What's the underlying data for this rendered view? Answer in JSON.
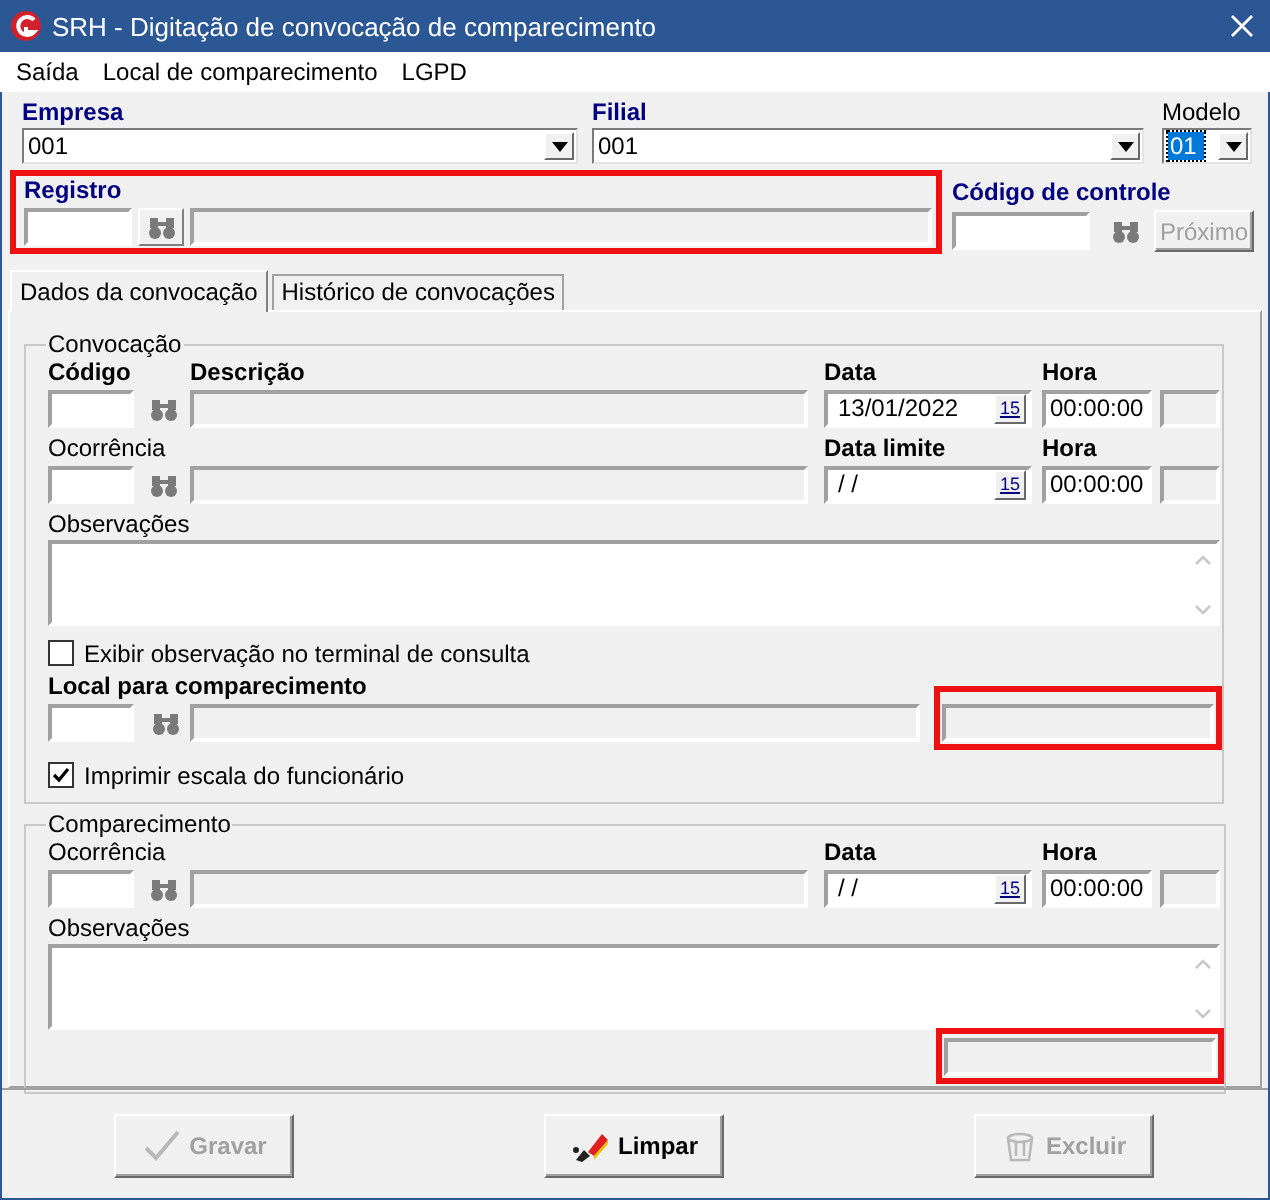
{
  "window": {
    "title": "SRH - Digitação de convocação de comparecimento"
  },
  "menu": [
    "Saída",
    "Local de comparecimento",
    "LGPD"
  ],
  "empresa": {
    "label": "Empresa",
    "value": "001"
  },
  "filial": {
    "label": "Filial",
    "value": "001"
  },
  "modelo": {
    "label": "Modelo",
    "value": "01",
    "focused": true
  },
  "registro": {
    "label": "Registro",
    "highlighted": true
  },
  "codigo_controle": {
    "label": "Código de controle",
    "button": "Próximo",
    "button_disabled": true
  },
  "tabs": [
    {
      "label": "Dados da convocação",
      "selected": true
    },
    {
      "label": "Histórico de convocações",
      "selected": false
    }
  ],
  "convocacao": {
    "title": "Convocação",
    "items": [
      {
        "kind": "lookup",
        "code_label": "Código",
        "code_bold": true,
        "desc_label": "Descrição",
        "date_label": "Data",
        "date": "13/01/2022",
        "calendar": "15",
        "time_label": "Hora",
        "time": "00:00:00"
      },
      {
        "kind": "lookup",
        "code_label": "Ocorrência",
        "code_bold": false,
        "date_label": "Data limite",
        "date": "/ /",
        "calendar": "15",
        "time_label": "Hora",
        "time": "00:00:00"
      },
      {
        "kind": "memo",
        "label": "Observações"
      },
      {
        "kind": "checkbox",
        "label": "Exibir observação no terminal de consulta",
        "checked": false
      },
      {
        "kind": "local",
        "label": "Local para comparecimento",
        "highlighted": true
      },
      {
        "kind": "checkbox",
        "label": "Imprimir escala do funcionário",
        "checked": true
      }
    ]
  },
  "comparecimento": {
    "title": "Comparecimento",
    "items": [
      {
        "kind": "lookup",
        "code_label": "Ocorrência",
        "code_bold": false,
        "date_label": "Data",
        "date": "/ /",
        "calendar": "15",
        "time_label": "Hora",
        "time": "00:00:00"
      },
      {
        "kind": "memo",
        "label": "Observações"
      },
      {
        "kind": "status",
        "highlighted": true
      }
    ]
  },
  "buttons": [
    {
      "kind": "save",
      "label": "Gravar",
      "disabled": true
    },
    {
      "kind": "clear",
      "label": "Limpar",
      "disabled": false
    },
    {
      "kind": "delete",
      "label": "Excluir",
      "disabled": true
    }
  ]
}
